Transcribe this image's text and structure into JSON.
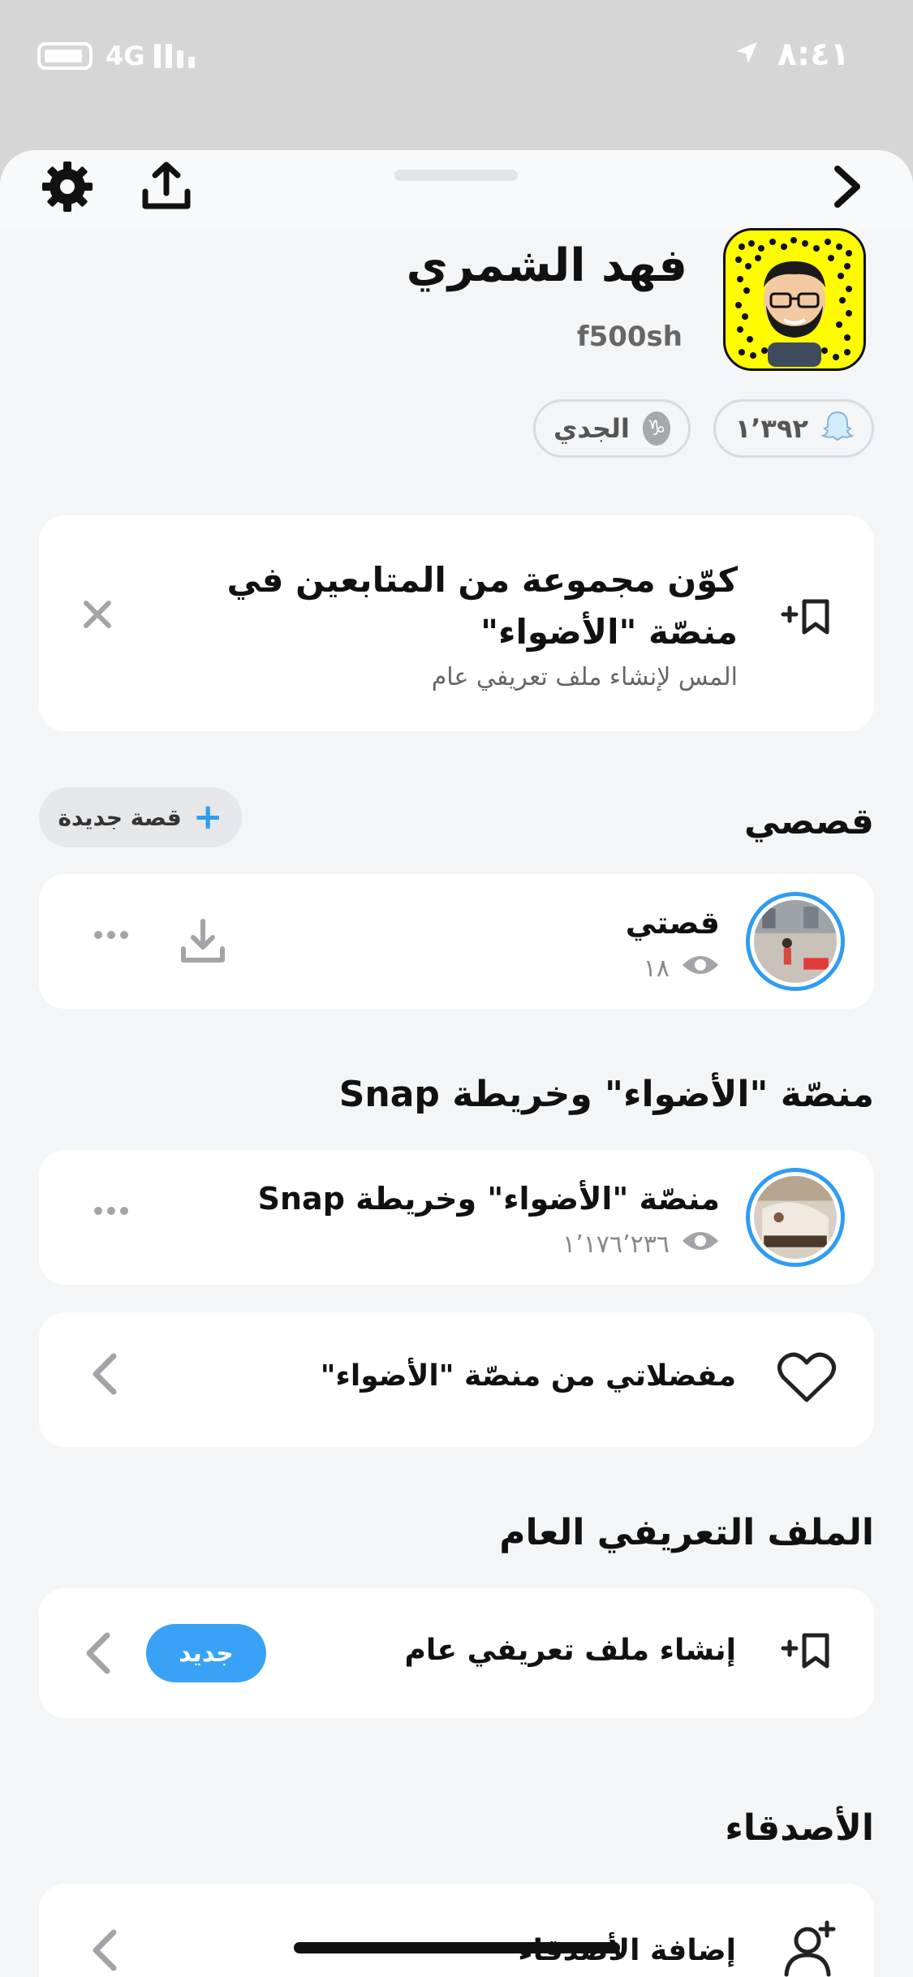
{
  "status_bar": {
    "time": "٨:٤١",
    "network": "4G"
  },
  "profile": {
    "display_name": "فهد الشمري",
    "username": "f500sh",
    "snap_score": "١٬٣٩٢",
    "zodiac": "الجدي"
  },
  "banner": {
    "title": "كوّن مجموعة من المتابعين في منصّة \"الأضواء\"",
    "subtitle": "المس لإنشاء ملف تعريفي عام"
  },
  "stories": {
    "section_title": "قصصي",
    "new_story_label": "قصة جديدة",
    "item": {
      "title": "قصتي",
      "views": "١٨"
    }
  },
  "spotlight": {
    "section_title": "منصّة \"الأضواء\" وخريطة Snap",
    "item": {
      "title": "منصّة \"الأضواء\" وخريطة Snap",
      "views": "١٬١٧٦٬٢٣٦"
    },
    "favorites_label": "مفضلاتي من منصّة \"الأضواء\""
  },
  "public_profile": {
    "section_title": "الملف التعريفي العام",
    "create_label": "إنشاء ملف تعريفي عام",
    "badge": "جديد"
  },
  "friends": {
    "section_title": "الأصدقاء",
    "add_label": "إضافة الأصدقاء"
  },
  "colors": {
    "accent": "#2f9cf4",
    "snapcode": "#fffc00"
  }
}
